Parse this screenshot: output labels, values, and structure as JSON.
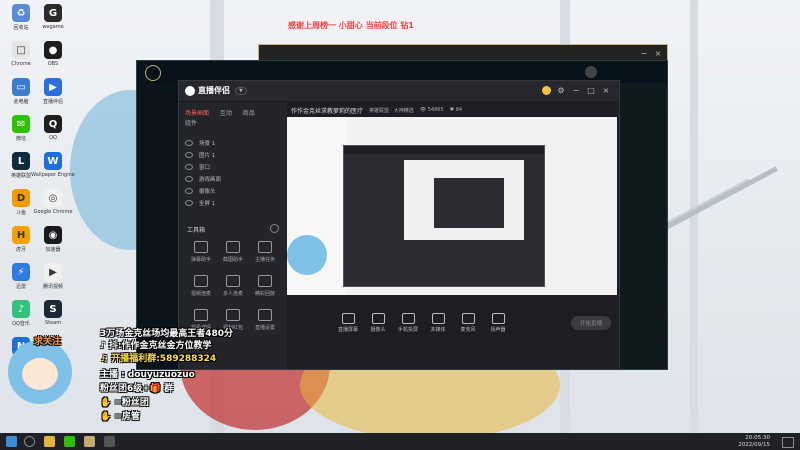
{
  "stream_top_text": "感谢上周榜一 小甜心    当前段位 钻1",
  "desktop_icons": [
    {
      "label": "回收站",
      "color": "#5b8ad6",
      "glyph": "♻"
    },
    {
      "label": "wegame",
      "color": "#2b2b2b",
      "glyph": "G"
    },
    {
      "label": "Chrome",
      "color": "#e5e5e5",
      "glyph": "□"
    },
    {
      "label": "OBS",
      "color": "#1d1d1d",
      "glyph": "●"
    },
    {
      "label": "此电脑",
      "color": "#3d7bd1",
      "glyph": "▭"
    },
    {
      "label": "直播伴侣",
      "color": "#2a6fdb",
      "glyph": "▶"
    },
    {
      "label": "微信",
      "color": "#2dc100",
      "glyph": "✉"
    },
    {
      "label": "QQ",
      "color": "#1e1e1e",
      "glyph": "Q"
    },
    {
      "label": "英雄联盟",
      "color": "#0f2a3c",
      "glyph": "L"
    },
    {
      "label": "Wallpaper Engine",
      "color": "#1e6fd9",
      "glyph": "W"
    },
    {
      "label": "斗鱼",
      "color": "#f59b00",
      "glyph": "D"
    },
    {
      "label": "Google Chrome",
      "color": "#f1f1f1",
      "glyph": "◎"
    },
    {
      "label": "虎牙",
      "color": "#f5a100",
      "glyph": "H"
    },
    {
      "label": "加速器",
      "color": "#1a1a1a",
      "glyph": "◉"
    },
    {
      "label": "迅雷",
      "color": "#2d7ae2",
      "glyph": "⚡"
    },
    {
      "label": "腾讯视频",
      "color": "#f0f0f0",
      "glyph": "▶"
    },
    {
      "label": "QQ音乐",
      "color": "#31c27c",
      "glyph": "♪"
    },
    {
      "label": "Steam",
      "color": "#1b2838",
      "glyph": "S"
    },
    {
      "label": "网易",
      "color": "#1e6ed6",
      "glyph": "N"
    }
  ],
  "obs": {
    "title": "直播伴侣",
    "title_sub": "",
    "nav_tabs": [
      "场景画面",
      "互动",
      "商品",
      "组件"
    ],
    "scene": "场景 1",
    "layers": [
      "图片 1",
      "窗口",
      "游戏画面",
      "摄像头",
      "全屏 1"
    ],
    "tools_title": "工具箱",
    "tools": [
      "弹幕助手",
      "截图助手",
      "主播任务",
      "视频连麦",
      "多人连麦",
      "精彩回放",
      "观看详情",
      "福利红包",
      "直播设置",
      "主播任务"
    ],
    "stream_title": "作作金克丝求教萝莉的医疗",
    "stream_sub": "英雄联盟 · 大神精选",
    "viewers": "54865",
    "likes": "84",
    "toolbar_btns": [
      "直播屏幕",
      "摄像头",
      "手机投屏",
      "多媒体",
      "麦克风",
      "扬声器"
    ],
    "go_live": "开始直播"
  },
  "overlay_lines": [
    "3万场金克丝场均最高王者480分",
    "♪ 抖:作作金克丝金方位教学",
    "♫ 开播福利群:589288324",
    "主播 : douyuzuozuo",
    "粉丝团6级+🎁 群",
    "✋ =粉丝团",
    "✋ =房管"
  ],
  "follow_label": "求关注",
  "taskbar": {
    "time": "20:05:30",
    "date": "2022/09/15"
  }
}
